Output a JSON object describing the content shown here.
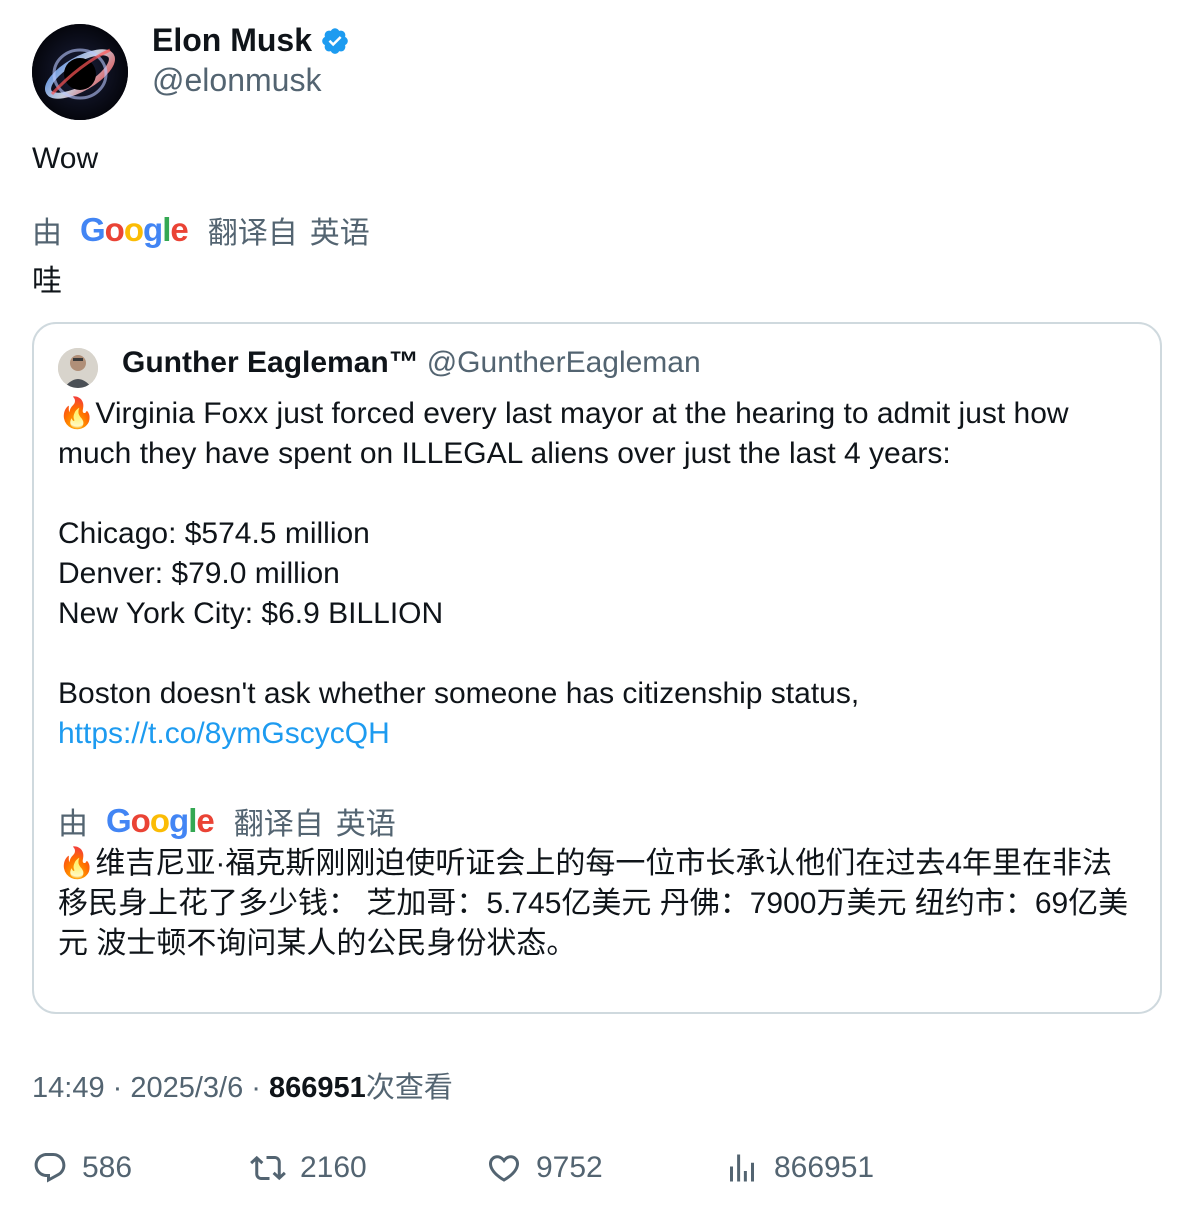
{
  "author": {
    "name": "Elon Musk",
    "handle": "@elonmusk",
    "verified_icon": "verified-badge-icon"
  },
  "tweet": {
    "text": "Wow",
    "translation": {
      "by": "由",
      "provider": "Google",
      "from": "翻译自",
      "language": "英语",
      "text": "哇"
    }
  },
  "quoted": {
    "name": "Gunther Eagleman™",
    "handle": "@GuntherEagleman",
    "lines": {
      "intro": "🔥Virginia Foxx just forced every last mayor at the hearing to admit just how much they have spent on ILLEGAL aliens over just the last 4 years:",
      "chicago": "Chicago: $574.5 million",
      "denver": "Denver: $79.0 million",
      "nyc": "New York City: $6.9 BILLION",
      "boston": "Boston doesn't ask whether someone has citizenship status,",
      "link": "https://t.co/8ymGscycQH"
    },
    "translation": {
      "by": "由",
      "provider": "Google",
      "from": "翻译自",
      "language": "英语",
      "text": "🔥维吉尼亚·福克斯刚刚迫使听证会上的每一位市长承认他们在过去4年里在非法移民身上花了多少钱： 芝加哥：5.745亿美元 丹佛：7900万美元 纽约市：69亿美元 波士顿不询问某人的公民身份状态。"
    }
  },
  "meta": {
    "time": "14:49",
    "sep1": " · ",
    "date": "2025/3/6",
    "sep2": " · ",
    "views": "866951",
    "views_label": "次查看"
  },
  "actions": {
    "replies": "586",
    "retweets": "2160",
    "likes": "9752",
    "views": "866951"
  },
  "colors": {
    "accent": "#1d9bf0",
    "secondary_text": "#536471",
    "border": "#cfd9de"
  }
}
